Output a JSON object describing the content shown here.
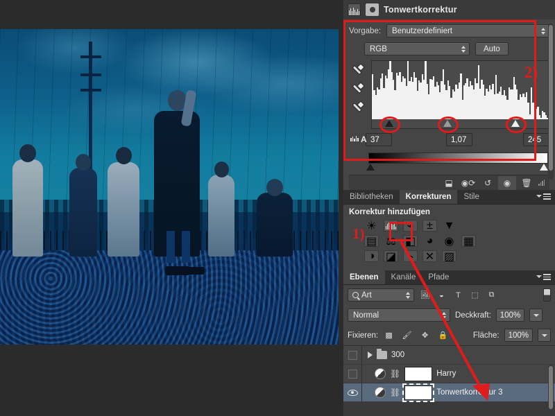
{
  "properties_panel": {
    "title": "Tonwertkorrektur",
    "icon_levels": "levels-icon",
    "icon_layer_thumb": "adjustment-circle-icon",
    "preset_label": "Vorgabe:",
    "preset_value": "Benutzerdefiniert",
    "channel_value": "RGB",
    "auto_button": "Auto",
    "annotation_2": "2)",
    "input_black": "37",
    "input_gamma": "1,07",
    "input_white": "245",
    "footer_icons": [
      "clip-to-layer-icon",
      "preview-toggle-icon",
      "reset-icon",
      "visibility-icon",
      "delete-icon"
    ]
  },
  "adjustments_panel": {
    "tabs": [
      {
        "label": "Bibliotheken",
        "active": false
      },
      {
        "label": "Korrekturen",
        "active": true
      },
      {
        "label": "Stile",
        "active": false
      }
    ],
    "heading": "Korrektur hinzufügen",
    "annotation_1": "1)",
    "row1": [
      "brightness-contrast-icon",
      "levels-icon",
      "curves-icon",
      "exposure-icon",
      "vibrance-icon"
    ],
    "row2": [
      "hue-saturation-icon",
      "color-balance-icon",
      "black-white-icon",
      "photo-filter-icon",
      "channel-mixer-icon",
      "color-lookup-icon"
    ],
    "row3": [
      "invert-icon",
      "posterize-icon",
      "threshold-icon",
      "selective-color-icon",
      "gradient-map-icon"
    ]
  },
  "layers_panel": {
    "tabs": [
      {
        "label": "Ebenen",
        "active": true
      },
      {
        "label": "Kanäle",
        "active": false
      },
      {
        "label": "Pfade",
        "active": false
      }
    ],
    "filter_value": "Art",
    "filter_icons": [
      "pixel-layer-icon",
      "adjustment-layer-icon",
      "type-layer-icon",
      "shape-layer-icon",
      "smart-object-icon"
    ],
    "blend_mode": "Normal",
    "opacity_label": "Deckkraft:",
    "opacity_value": "100%",
    "lock_label": "Fixieren:",
    "lock_icons": [
      "lock-transparent-pixels-icon",
      "lock-image-pixels-icon",
      "lock-position-icon",
      "lock-all-icon"
    ],
    "fill_label": "Fläche:",
    "fill_value": "100%",
    "layers": [
      {
        "name": "300",
        "type": "group",
        "visible": false,
        "selected": false
      },
      {
        "name": "Harry",
        "type": "adjustment",
        "visible": false,
        "selected": false
      },
      {
        "name": "Tonwertkorrektur 3",
        "type": "adjustment",
        "visible": true,
        "selected": true
      }
    ]
  },
  "annotations": {
    "highlight_color": "#e01b1b",
    "arrow": "red-arrow-from-levels-icon-to-levels-layer"
  },
  "canvas": {
    "document_title": "photo-canvas"
  }
}
